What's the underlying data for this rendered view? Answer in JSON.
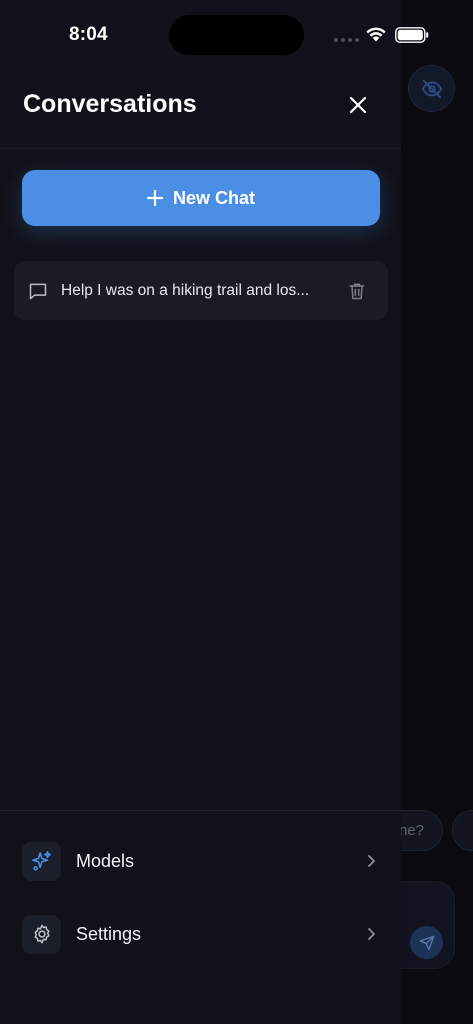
{
  "status_bar": {
    "time": "8:04"
  },
  "drawer": {
    "title": "Conversations",
    "new_chat_label": "New Chat",
    "conversations": [
      {
        "title": "Help I was on a hiking trail and los..."
      }
    ],
    "menu": [
      {
        "label": "Models",
        "icon": "sparkles-icon"
      },
      {
        "label": "Settings",
        "icon": "gear-icon"
      }
    ]
  },
  "background": {
    "chip_text": "ne?"
  },
  "colors": {
    "accent": "#4a8fe4",
    "drawer_bg": "#11111b",
    "item_bg": "#1a1b25"
  }
}
